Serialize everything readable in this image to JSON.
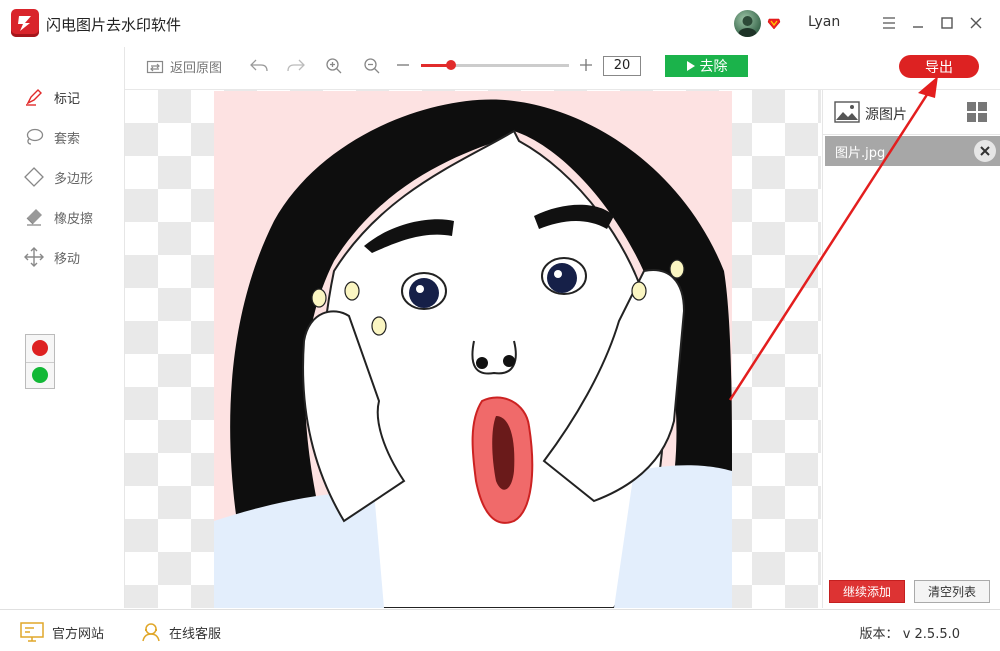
{
  "app": {
    "title": "闪电图片去水印软件",
    "user_name": "Lyan"
  },
  "window_controls": {
    "menu": "menu-icon",
    "minimize": "minimize-icon",
    "maximize": "maximize-icon",
    "close": "close-icon"
  },
  "toolbar": {
    "restore_label": "返回原图",
    "brush_size": "20",
    "brush_slider_fraction": 0.2,
    "remove_label": "去除",
    "export_label": "导出"
  },
  "sidebar": {
    "items": [
      {
        "label": "标记",
        "icon": "marker-icon"
      },
      {
        "label": "套索",
        "icon": "lasso-icon"
      },
      {
        "label": "多边形",
        "icon": "polygon-icon"
      },
      {
        "label": "橡皮擦",
        "icon": "eraser-icon"
      },
      {
        "label": "移动",
        "icon": "move-icon"
      }
    ],
    "colors": [
      "#dd2020",
      "#12b836"
    ],
    "active_color": "#e12b2b"
  },
  "right_panel": {
    "source_label": "源图片",
    "files": [
      {
        "name": "图片.jpg"
      }
    ],
    "add_label": "继续添加",
    "clear_label": "清空列表"
  },
  "status": {
    "website_label": "官方网站",
    "support_label": "在线客服",
    "version_label": "版本：",
    "version": "v 2.5.5.0"
  },
  "colors": {
    "accent_red": "#dd2222",
    "accent_green": "#1bb34b"
  }
}
